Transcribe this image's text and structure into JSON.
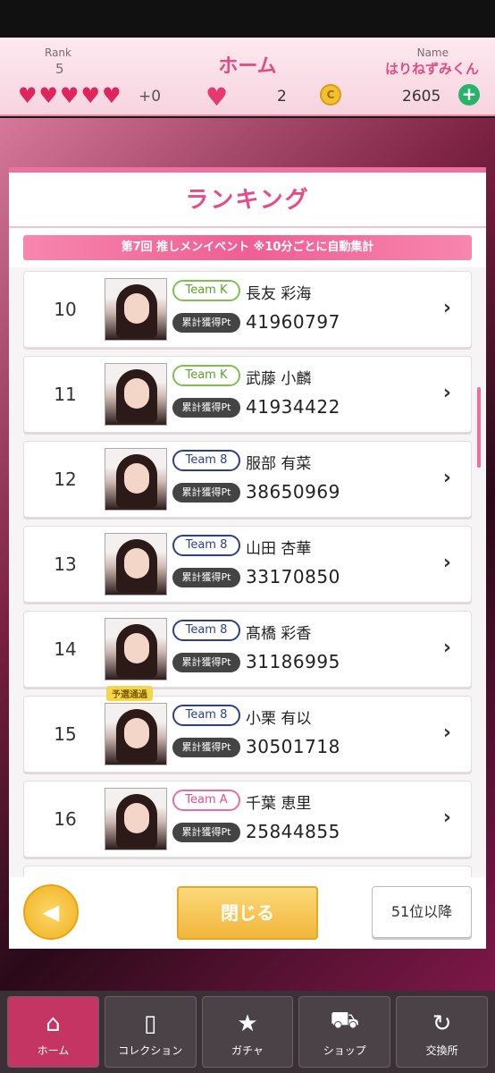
{
  "header": {
    "rank_label": "Rank",
    "rank_value": "5",
    "title": "ホーム",
    "name_label": "Name",
    "name_value": "はりねずみくん",
    "hearts_extra": "+0",
    "gem_count": "2",
    "coin_count": "2605"
  },
  "modal": {
    "title": "ランキング",
    "event_banner": "第7回 推しメンイベント ※10分ごとに自動集計",
    "pt_label": "累計獲得Pt",
    "pass_tag": "予選通過",
    "close_label": "閉じる",
    "more_label": "51位以降",
    "back_symbol": "◀"
  },
  "ranking": [
    {
      "rank": "10",
      "team": "Team K",
      "name": "長友 彩海",
      "points": "41960797"
    },
    {
      "rank": "11",
      "team": "Team K",
      "name": "武藤 小麟",
      "points": "41934422"
    },
    {
      "rank": "12",
      "team": "Team 8",
      "name": "服部 有菜",
      "points": "38650969"
    },
    {
      "rank": "13",
      "team": "Team 8",
      "name": "山田 杏華",
      "points": "33170850"
    },
    {
      "rank": "14",
      "team": "Team 8",
      "name": "髙橋 彩香",
      "points": "31186995"
    },
    {
      "rank": "15",
      "team": "Team 8",
      "name": "小栗 有以",
      "points": "30501718"
    },
    {
      "rank": "16",
      "team": "Team A",
      "name": "千葉 恵里",
      "points": "25844855"
    }
  ],
  "nav": [
    {
      "label": "ホーム",
      "icon": "home-icon"
    },
    {
      "label": "コレクション",
      "icon": "collection-icon"
    },
    {
      "label": "ガチャ",
      "icon": "gacha-icon"
    },
    {
      "label": "ショップ",
      "icon": "cart-icon"
    },
    {
      "label": "交換所",
      "icon": "exchange-icon"
    }
  ],
  "colors": {
    "accent": "#e84b87",
    "teamK": "#7cc24a",
    "team8": "#2b3f8f",
    "teamA": "#e86ea0"
  }
}
